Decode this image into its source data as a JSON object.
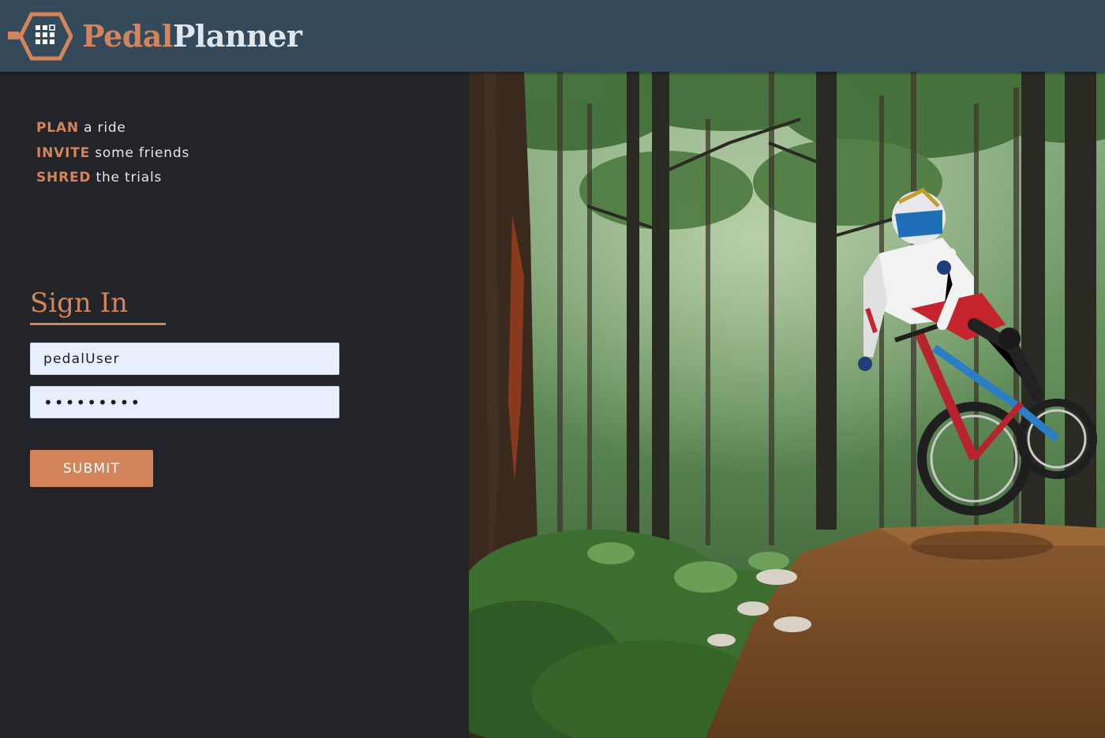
{
  "header": {
    "brand_primary": "Pedal",
    "brand_secondary": "Planner",
    "logo_icon": "hexagon-grid-logo-icon"
  },
  "tagline": [
    {
      "keyword": "PLAN",
      "rest": "a ride"
    },
    {
      "keyword": "INVITE",
      "rest": "some friends"
    },
    {
      "keyword": "SHRED",
      "rest": "the trials"
    }
  ],
  "signin": {
    "title": "Sign In",
    "username_value": "pedalUser",
    "password_value": "•••••••••",
    "submit_label": "SUBMIT"
  },
  "colors": {
    "accent": "#d4845a",
    "header_bg": "#34495a",
    "panel_bg": "#222429",
    "input_bg": "#e8effc"
  },
  "hero": {
    "description_icon": "mountain-bike-forest-photo"
  }
}
